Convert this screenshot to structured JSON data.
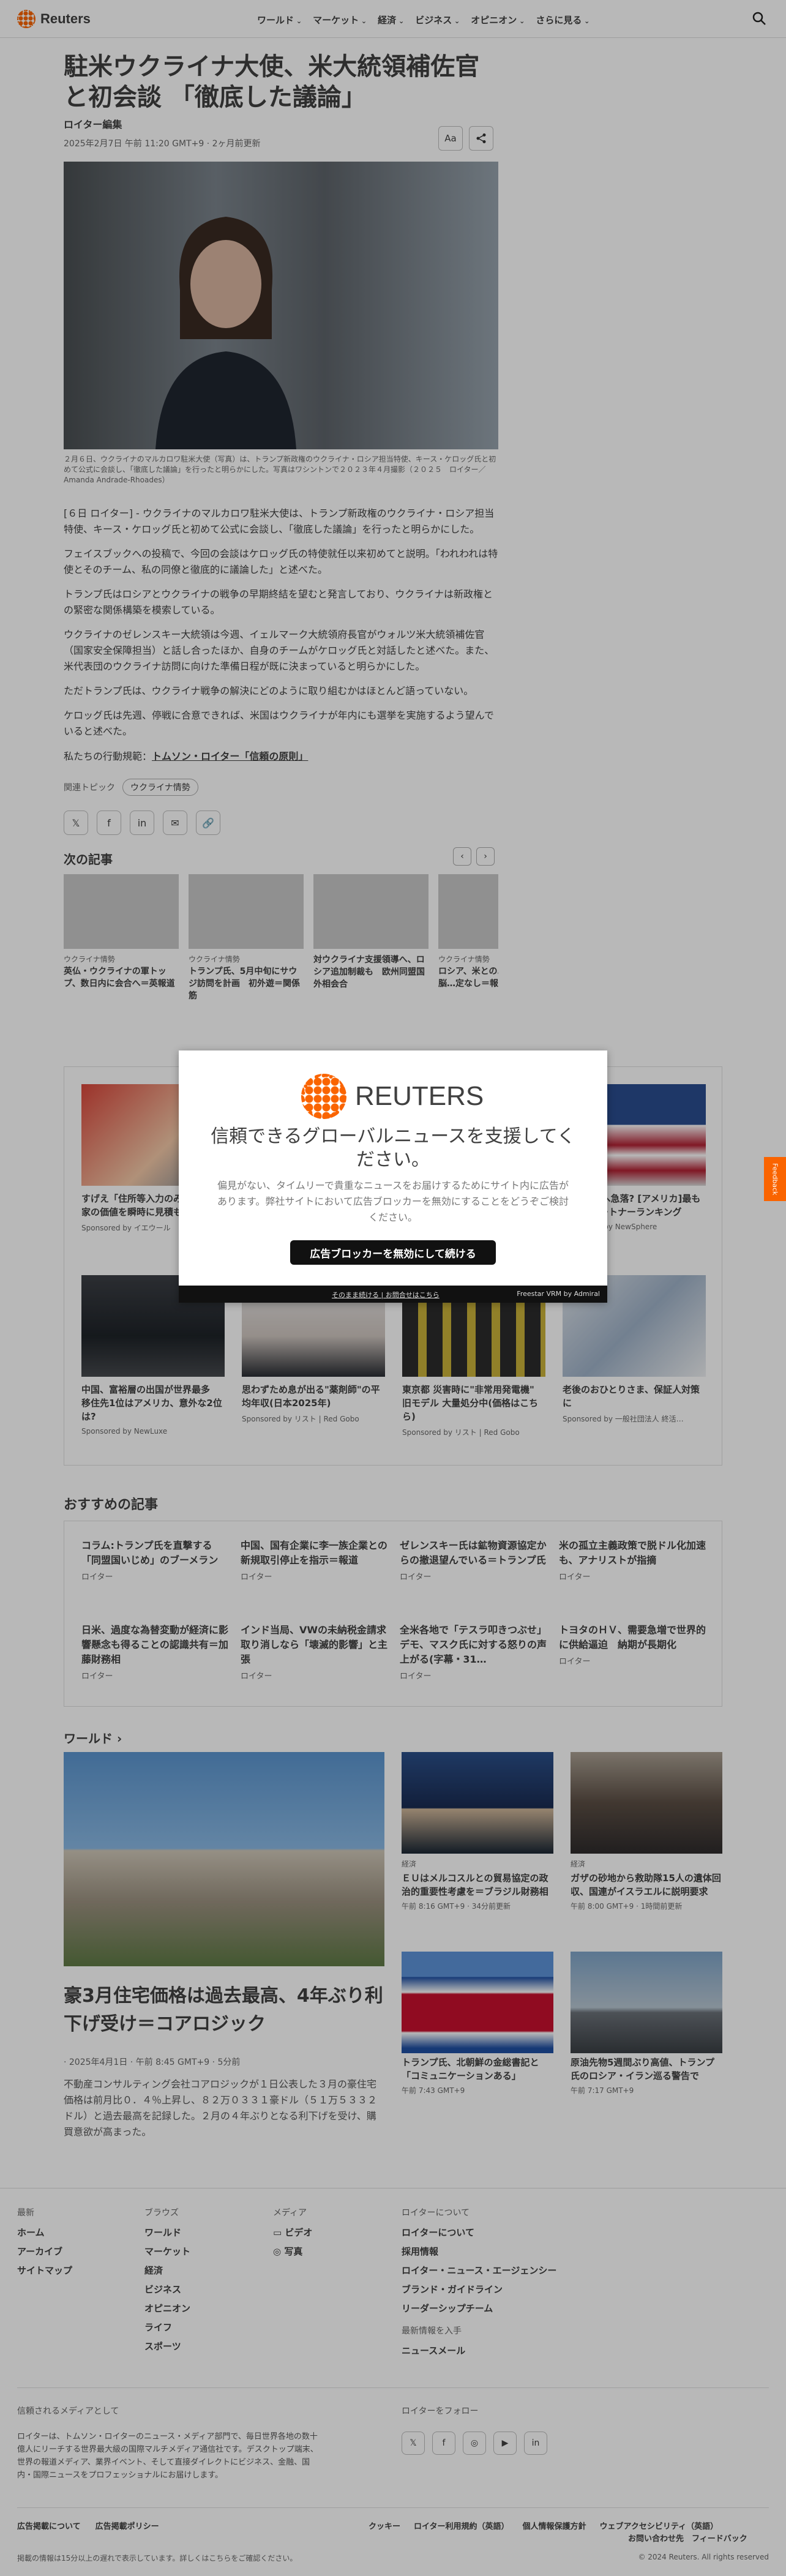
{
  "header": {
    "brand": "Reuters",
    "nav": [
      "ワールド",
      "マーケット",
      "経済",
      "ビジネス",
      "オピニオン",
      "さらに見る"
    ]
  },
  "article": {
    "title": "駐米ウクライナ大使、米大統領補佐官と初会談 「徹底した議論」",
    "byline": "ロイター編集",
    "date": "2025年2月7日 午前 11:20 GMT+9 · 2ヶ月前更新",
    "text_size_label": "Aa",
    "caption": "２月６日、ウクライナのマルカロワ駐米大使（写真）は、トランプ新政権のウクライナ・ロシア担当特使、キース・ケロッグ氏と初めて公式に会談し、「徹底した議論」を行ったと明らかにした。写真はワシントンで２０２３年４月撮影（２０２５　ロイター／Amanda Andrade-Rhoades）",
    "paragraphs": [
      "[６日 ロイター] - ウクライナのマルカロワ駐米大使は、トランプ新政権のウクライナ・ロシア担当特使、キース・ケロッグ氏と初めて公式に会談し、「徹底した議論」を行ったと明らかにした。",
      "フェイスブックへの投稿で、今回の会談はケロッグ氏の特使就任以来初めてと説明。「われわれは特使とそのチーム、私の同僚と徹底的に議論した」と述べた。",
      "トランプ氏はロシアとウクライナの戦争の早期終結を望むと発言しており、ウクライナは新政権との緊密な関係構築を模索している。",
      "ウクライナのゼレンスキー大統領は今週、イェルマーク大統領府長官がウォルツ米大統領補佐官（国家安全保障担当）と話し合ったほか、自身のチームがケロッグ氏と対話したと述べた。また、米代表団のウクライナ訪問に向けた準備日程が既に決まっていると明らかにした。",
      "ただトランプ氏は、ウクライナ戦争の解決にどのように取り組むかはほとんど語っていない。",
      "ケロッグ氏は先週、停戦に合意できれば、米国はウクライナが年内にも選挙を実施するよう望んでいると述べた。"
    ],
    "principles_prefix": "私たちの行動規範：",
    "principles_link": "トムソン・ロイター「信頼の原則」",
    "related_label": "関連トピック",
    "related_chip": "ウクライナ情勢"
  },
  "share_icons": [
    "x-icon",
    "facebook-icon",
    "linkedin-icon",
    "mail-icon",
    "link-icon"
  ],
  "next": {
    "heading": "次の記事",
    "cards": [
      {
        "cat": "ウクライナ情勢",
        "title": "英仏・ウクライナの軍トップ、数日内に会合へ＝英報道"
      },
      {
        "cat": "ウクライナ情勢",
        "title": "トランプ氏、5月中旬にサウジ訪問を計画　初外遊＝関係筋"
      },
      {
        "cat": "",
        "title": "対ウクライナ支援領導へ、ロシア追加制裁も　欧州同盟国外相会合"
      },
      {
        "cat": "ウクライナ情勢",
        "title": "ロシア、米との…国内の首脳…定なし＝報道"
      }
    ]
  },
  "sponsored": [
    {
      "title": "すげえ「住所等入力のみで」OK!家の価値を瞬時に見積もるサイト",
      "src": "Sponsored by イエウール"
    },
    {
      "title": "",
      "src": ""
    },
    {
      "title": "",
      "src": ""
    },
    {
      "title": "…→33%へ急落? [アメリカ]最も重要なパートナーランキング",
      "src": "Sponsored by NewSphere"
    },
    {
      "title": "中国、富裕層の出国が世界最多　移住先1位はアメリカ、意外な2位は?",
      "src": "Sponsored by NewLuxe"
    },
    {
      "title": "思わずため息が出る\"薬剤師\"の平均年収(日本2025年)",
      "src": "Sponsored by リスト | Red Gobo"
    },
    {
      "title": "東京都 災害時に\"非常用発電機\" 旧モデル 大量処分中(価格はこちら)",
      "src": "Sponsored by リスト | Red Gobo"
    },
    {
      "title": "老後のおひとりさま、保証人対策に",
      "src": "Sponsored by 一般社団法人 終活…"
    }
  ],
  "recommended": {
    "heading": "おすすめの記事",
    "items": [
      {
        "title": "コラム:トランプ氏を直撃する「同盟国いじめ」のブーメラン",
        "src": "ロイター"
      },
      {
        "title": "中国、国有企業に李一族企業との新規取引停止を指示＝報道",
        "src": "ロイター"
      },
      {
        "title": "ゼレンスキー氏は鉱物資源協定からの撤退望んでいる＝トランプ氏",
        "src": "ロイター"
      },
      {
        "title": "米の孤立主義政策で脱ドル化加速も、アナリストが指摘",
        "src": "ロイター"
      },
      {
        "title": "日米、過度な為替変動が経済に影響懸念も得ることの認識共有＝加藤財務相",
        "src": "ロイター"
      },
      {
        "title": "インド当局、VWの未納税金請求取り消しなら「壊滅的影響」と主張",
        "src": "ロイター"
      },
      {
        "title": "全米各地で「テスラ叩きつぶせ」デモ、マスク氏に対する怒りの声上がる(字幕・31…",
        "src": "ロイター"
      },
      {
        "title": "トヨタのＨＶ、需要急増で世界的に供給逼迫　納期が長期化",
        "src": "ロイター"
      }
    ]
  },
  "world": {
    "heading": "ワールド",
    "main": {
      "title": "豪3月住宅価格は過去最高、4年ぶり利下げ受け＝コアロジック",
      "date": "· 2025年4月1日 · 午前 8:45 GMT+9 · 5分前",
      "summary": "不動産コンサルティング会社コアロジックが１日公表した３月の豪住宅価格は前月比０．４％上昇し、８２万０３３１豪ドル（５１万５３３２ドル）と過去最高を記録した。２月の４年ぶりとなる利下げを受け、購買意欲が高まった。"
    },
    "items": [
      {
        "cat": "経済",
        "title": "ＥＵはメルコスルとの貿易協定の政治的重要性考慮を＝ブラジル財務相",
        "date": "午前 8:16 GMT+9 · 34分前更新"
      },
      {
        "cat": "経済",
        "title": "ガザの砂地から救助隊15人の遺体回収、国連がイスラエルに説明要求",
        "date": "午前 8:00 GMT+9 · 1時間前更新"
      },
      {
        "cat": "",
        "title": "トランプ氏、北朝鮮の金総書記と「コミュニケーションある」",
        "date": "午前 7:43 GMT+9"
      },
      {
        "cat": "",
        "title": "原油先物5週間ぶり高値、トランプ氏のロシア・イラン巡る警告で",
        "date": "午前 7:17 GMT+9"
      }
    ]
  },
  "footer": {
    "col1": {
      "h": "最新",
      "links": [
        "ホーム",
        "アーカイブ",
        "サイトマップ"
      ]
    },
    "col2": {
      "h": "ブラウズ",
      "links": [
        "ワールド",
        "マーケット",
        "経済",
        "ビジネス",
        "オピニオン",
        "ライフ",
        "スポーツ"
      ]
    },
    "col3": {
      "h": "メディア",
      "links": [
        "ビデオ",
        "写真"
      ]
    },
    "col4": {
      "h": "ロイターについて",
      "links": [
        "ロイターについて",
        "採用情報",
        "ロイター・ニュース・エージェンシー",
        "ブランド・ガイドライン",
        "リーダーシップチーム"
      ]
    },
    "latest_h": "最新情報を入手",
    "newsletter": "ニュースメール",
    "trusted_h": "信頼されるメディアとして",
    "trusted_desc": "ロイターは、トムソン・ロイターのニュース・メディア部門で、毎日世界各地の数十億人にリーチする世界最大級の国際マルチメディア通信社です。デスクトップ端末、世界の報道メディア、業界イベント、そして直接ダイレクトにビジネス、金融、国内・国際ニュースをプロフェッショナルにお届けします。",
    "follow_h": "ロイターをフォロー",
    "links_left": [
      "広告掲載について",
      "広告掲載ポリシー"
    ],
    "links_right": [
      "クッキー",
      "ロイター利用規約（英語）",
      "個人情報保護方針",
      "ウェブアクセシビリティ（英語）"
    ],
    "feedback": "お問い合わせ先　フィードバック",
    "note": "掲載の情報は15分以上の遅れで表示しています。詳しくはこちらをご確認ください。",
    "copyright": "© 2024 Reuters. All rights reserved"
  },
  "modal": {
    "brand": "REUTERS",
    "title": "信頼できるグローバルニュースを支援してください。",
    "body": "偏見がない、タイムリーで貴重なニュースをお届けするためにサイト内に広告があります。弊社サイトにおいて広告ブロッカーを無効にすることをどうぞご検討ください。",
    "button": "広告ブロッカーを無効にして続ける",
    "continue": "そのまま続ける | お問合せはこちら",
    "freestar": "Freestar VRM  by Admiral"
  },
  "feedback_tab": "Feedback"
}
